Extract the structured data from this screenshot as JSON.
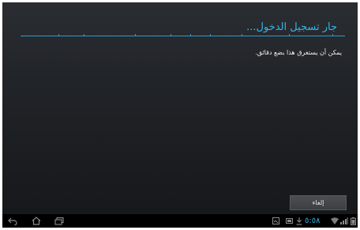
{
  "dialog": {
    "title": "جار تسجيل الدخول...",
    "message": "يمكن أن يستغرق هذا بضع دقائق.",
    "cancel_label": "إلغاء"
  },
  "status_bar": {
    "time": "٥:٥٨",
    "icons": [
      "screenshot-icon",
      "image-icon",
      "download-icon",
      "wifi-icon",
      "signal-icon",
      "battery-icon"
    ]
  },
  "nav_bar": {
    "icons": [
      "back-icon",
      "home-icon",
      "recent-apps-icon"
    ]
  },
  "colors": {
    "accent": "#33b5e5",
    "background": "#1e2125"
  }
}
